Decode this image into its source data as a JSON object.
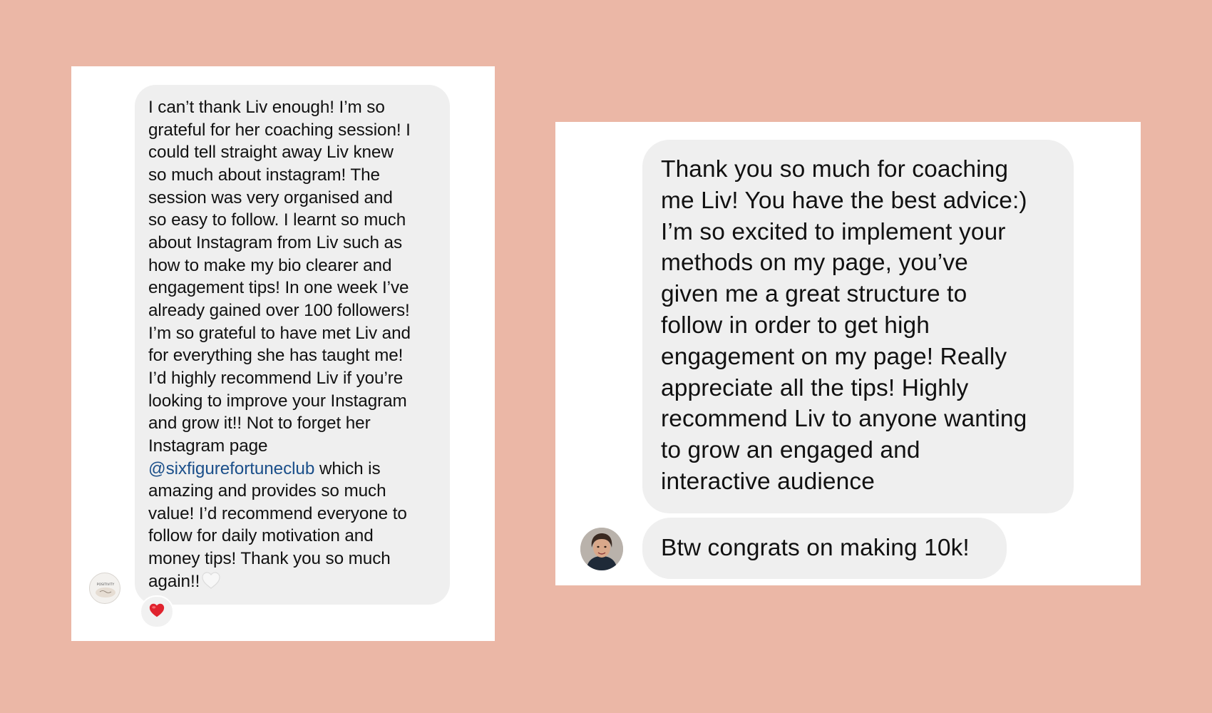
{
  "left_chat": {
    "message_lines": [
      "I can’t thank Liv enough! I’m so",
      "grateful for her coaching session! I",
      "could tell straight away Liv knew",
      "so much about instagram! The",
      "session was very organised and",
      "so easy to follow. I learnt so much",
      "about Instagram from Liv such as",
      "how to make my bio clearer and",
      "engagement tips! In one week I’ve",
      "already gained over 100 followers!",
      "I’m so grateful to have met Liv and",
      "for everything she has taught me!",
      "I’d highly recommend Liv if you’re",
      "looking to improve your Instagram",
      "and grow it!! Not to forget her",
      "Instagram page"
    ],
    "mention": "@sixfigurefortuneclub",
    "mention_tail": " which is",
    "message_lines_after": [
      "amazing and provides so much",
      "value! I’d recommend everyone to",
      "follow for daily motivation and",
      "money tips! Thank you so much"
    ],
    "last_line": "again!!",
    "trailing_emoji": "white-heart-icon",
    "reaction_emoji": "red-heart-icon",
    "avatar_logo_text": "POSITIVITY"
  },
  "right_chat": {
    "message_lines": [
      "Thank you so much for coaching",
      "me Liv! You have the best advice:)",
      "I’m so excited to implement your",
      "methods on my page, you’ve",
      "given me a great structure to",
      "follow in order to get high",
      "engagement on my page! Really",
      "appreciate all the tips! Highly",
      "recommend Liv to anyone wanting",
      "to grow an engaged and",
      "interactive audience"
    ],
    "followup_message": "Btw congrats on making 10k!"
  },
  "colors": {
    "background": "#ebb7a6",
    "card": "#ffffff",
    "bubble": "#efefef",
    "mention": "#1b4f8a",
    "reaction_heart": "#e0232e"
  }
}
